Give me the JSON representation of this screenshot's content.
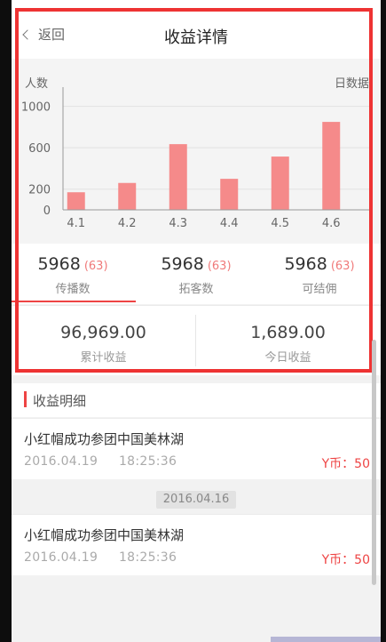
{
  "nav": {
    "back_label": "返回",
    "title": "收益详情"
  },
  "chart_data": {
    "type": "bar",
    "ylabel": "人数",
    "right_label": "日数据",
    "categories": [
      "4.1",
      "4.2",
      "4.3",
      "4.4",
      "4.5",
      "4.6"
    ],
    "values": [
      170,
      260,
      635,
      300,
      515,
      850
    ],
    "yticks": [
      0,
      200,
      600,
      1000
    ],
    "ylim": [
      0,
      1100
    ],
    "bar_color": "#f58a8a",
    "grid": true
  },
  "stats": [
    {
      "value": "5968",
      "sub": "(63)",
      "label": "传播数"
    },
    {
      "value": "5968",
      "sub": "(63)",
      "label": "拓客数"
    },
    {
      "value": "5968",
      "sub": "(63)",
      "label": "可结佣"
    }
  ],
  "totals": [
    {
      "value": "96,969.00",
      "label": "累计收益"
    },
    {
      "value": "1,689.00",
      "label": "今日收益"
    }
  ],
  "section": {
    "title": "收益明细"
  },
  "records": [
    {
      "title": "小红帽成功参团中国美林湖",
      "date": "2016.04.19",
      "time": "18:25:36",
      "coin": "Y币：50"
    },
    {
      "title": "小红帽成功参团中国美林湖",
      "date": "2016.04.19",
      "time": "18:25:36",
      "coin": "Y币：50"
    }
  ],
  "date_separator": "2016.04.16",
  "colors": {
    "accent": "#ee4444",
    "highlight_border": "#ee3333"
  }
}
